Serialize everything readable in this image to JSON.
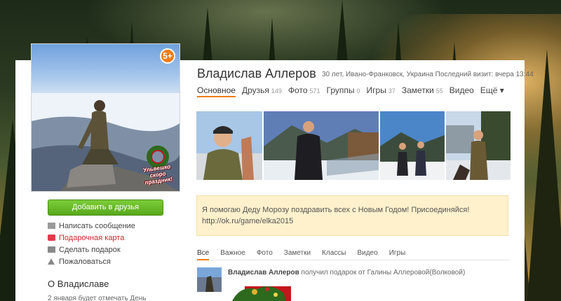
{
  "profile": {
    "name": "Владислав Аллеров",
    "meta": "30 лет, Ивано-Франковск, Украина Последний визит: вчера 13:44",
    "age_badge": "5+",
    "sticker_text": "Ульвешко скоро праздник!"
  },
  "nav": [
    {
      "label": "Основное",
      "count": "",
      "active": true
    },
    {
      "label": "Друзья",
      "count": "149"
    },
    {
      "label": "Фото",
      "count": "571"
    },
    {
      "label": "Группы",
      "count": "0"
    },
    {
      "label": "Игры",
      "count": "37"
    },
    {
      "label": "Заметки",
      "count": "55"
    },
    {
      "label": "Видео",
      "count": ""
    },
    {
      "label": "Ещё ▾",
      "count": ""
    }
  ],
  "sidebar": {
    "add_friend": "Добавить в друзья",
    "actions": [
      {
        "label": "Написать сообщение",
        "icon": "mail-icon"
      },
      {
        "label": "Подарочная карта",
        "icon": "gift-card-icon"
      },
      {
        "label": "Сделать подарок",
        "icon": "gift-icon"
      },
      {
        "label": "Пожаловаться",
        "icon": "warning-icon"
      }
    ],
    "about_title": "О Владиславе",
    "about_text": "2 января будет отмечать День"
  },
  "banner": {
    "text": "Я помогаю Деду Морозу поздравить всех с Новым Годом! Присоединяйся!",
    "link": "http://ok.ru/game/elka2015"
  },
  "feed": {
    "tabs": [
      "Все",
      "Важное",
      "Фото",
      "Заметки",
      "Классы",
      "Видео",
      "Игры"
    ],
    "item": {
      "author": "Владислав Аллеров",
      "action": "получил подарок от Галины Аллеровой(Волковой)"
    }
  },
  "colors": {
    "accent": "#f07c14",
    "add_button": "#66b825",
    "banner_bg": "#fff1cc",
    "report_red": "#d0262c"
  }
}
